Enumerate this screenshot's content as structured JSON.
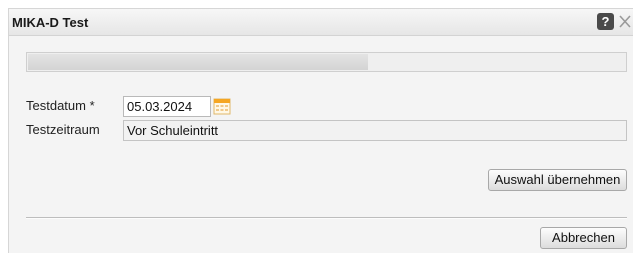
{
  "dialog": {
    "title": "MIKA-D Test",
    "help_glyph": "?",
    "close_icon": "close-icon"
  },
  "progress": {
    "fraction": 0.57
  },
  "form": {
    "testdatum_label": "Testdatum *",
    "testdatum_value": "05.03.2024",
    "calendar_icon": "calendar-icon",
    "testzeitraum_label": "Testzeitraum",
    "testzeitraum_value": "Vor Schuleintritt"
  },
  "buttons": {
    "apply_label": "Auswahl übernehmen",
    "cancel_label": "Abbrechen"
  },
  "colors": {
    "calendar_accent": "#f5a623"
  }
}
